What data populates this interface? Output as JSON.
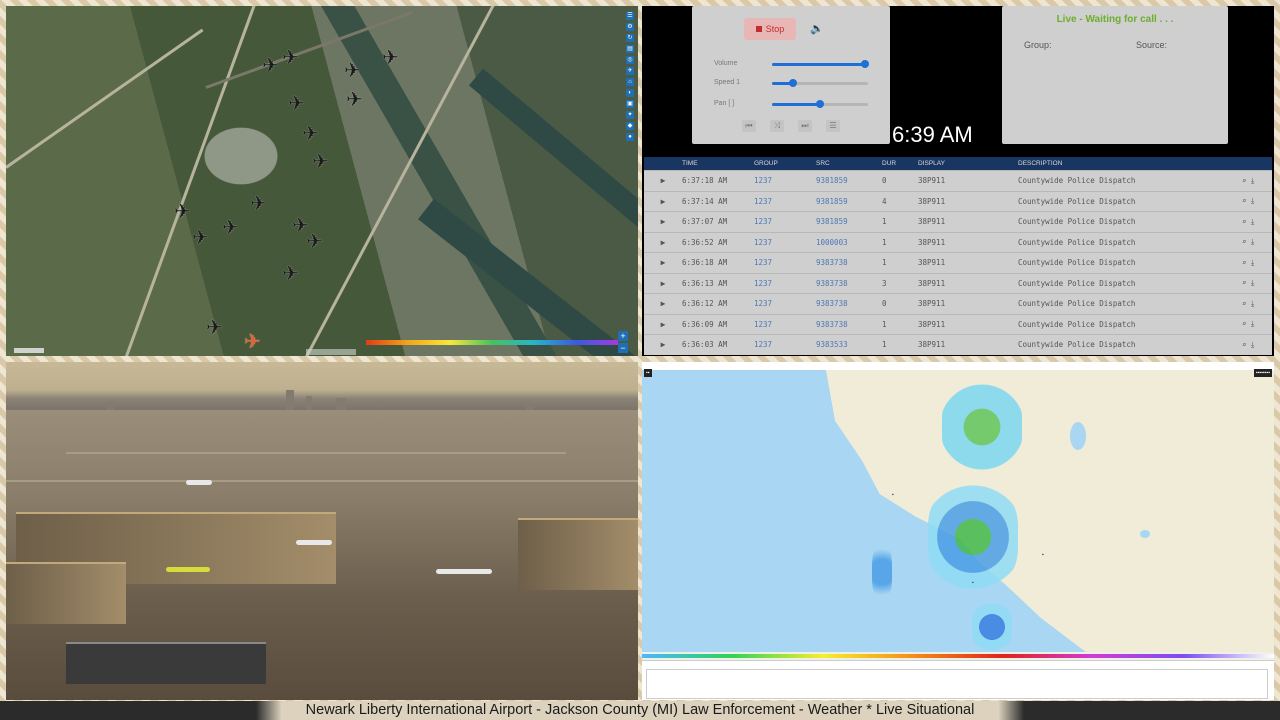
{
  "scanner": {
    "stop_label": "Stop",
    "sliders": [
      {
        "label": "Volume",
        "value": 0.97
      },
      {
        "label": "Speed 1",
        "value": 0.22
      },
      {
        "label": "Pan [ ]",
        "value": 0.5
      }
    ],
    "clock": "6:39 AM",
    "live_status": "Live - Waiting for call . . .",
    "group_label": "Group:",
    "source_label": "Source:",
    "columns": [
      "TIME",
      "GROUP",
      "SRC",
      "DUR",
      "DISPLAY",
      "DESCRIPTION"
    ],
    "calls": [
      {
        "time": "6:37:18 AM",
        "group": "1237",
        "src": "9381859",
        "dur": "0",
        "display": "38P911",
        "desc": "Countywide Police Dispatch"
      },
      {
        "time": "6:37:14 AM",
        "group": "1237",
        "src": "9381859",
        "dur": "4",
        "display": "38P911",
        "desc": "Countywide Police Dispatch"
      },
      {
        "time": "6:37:07 AM",
        "group": "1237",
        "src": "9381859",
        "dur": "1",
        "display": "38P911",
        "desc": "Countywide Police Dispatch"
      },
      {
        "time": "6:36:52 AM",
        "group": "1237",
        "src": "1000003",
        "dur": "1",
        "display": "38P911",
        "desc": "Countywide Police Dispatch"
      },
      {
        "time": "6:36:18 AM",
        "group": "1237",
        "src": "9383738",
        "dur": "1",
        "display": "38P911",
        "desc": "Countywide Police Dispatch"
      },
      {
        "time": "6:36:13 AM",
        "group": "1237",
        "src": "9383738",
        "dur": "3",
        "display": "38P911",
        "desc": "Countywide Police Dispatch"
      },
      {
        "time": "6:36:12 AM",
        "group": "1237",
        "src": "9383738",
        "dur": "0",
        "display": "38P911",
        "desc": "Countywide Police Dispatch"
      },
      {
        "time": "6:36:09 AM",
        "group": "1237",
        "src": "9383738",
        "dur": "1",
        "display": "38P911",
        "desc": "Countywide Police Dispatch"
      },
      {
        "time": "6:36:03 AM",
        "group": "1237",
        "src": "9383533",
        "dur": "1",
        "display": "38P911",
        "desc": "Countywide Police Dispatch"
      }
    ]
  },
  "ticker": {
    "text": "Newark Liberty International Airport - Jackson County (MI) Law Enforcement - Weather * Live Situational"
  },
  "colors": {
    "table_header": "#193562",
    "stop_red": "#c12e2e",
    "live_green": "#6dae2e",
    "slider_blue": "#1f6fd6"
  }
}
